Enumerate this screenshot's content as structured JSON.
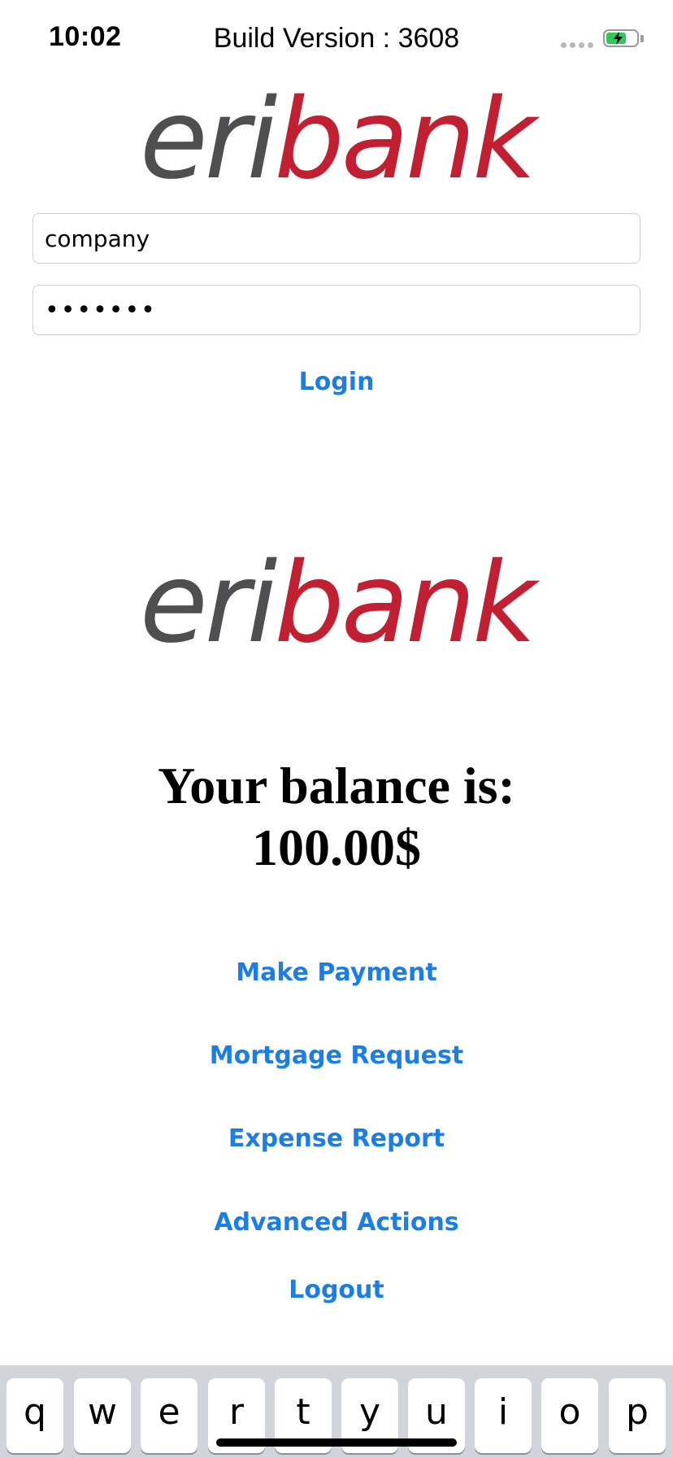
{
  "status_bar": {
    "time": "10:02",
    "build": "Build Version : 3608",
    "battery_color": "#34c759"
  },
  "logo": {
    "part_gray": "eri",
    "part_red": "bank",
    "gray_color": "#4f4f51",
    "red_color": "#c12033"
  },
  "login": {
    "username_value": "company",
    "password_value": "•••••••",
    "login_label": "Login"
  },
  "account": {
    "balance_line1": "Your balance is:",
    "balance_line2": "100.00$"
  },
  "actions": {
    "make_payment": "Make Payment",
    "mortgage_request": "Mortgage Request",
    "expense_report": "Expense Report",
    "advanced_actions": "Advanced Actions",
    "logout": "Logout",
    "link_color": "#1a7ee6"
  },
  "keyboard": {
    "keys": [
      "q",
      "w",
      "e",
      "r",
      "t",
      "y",
      "u",
      "i",
      "o",
      "p"
    ]
  }
}
